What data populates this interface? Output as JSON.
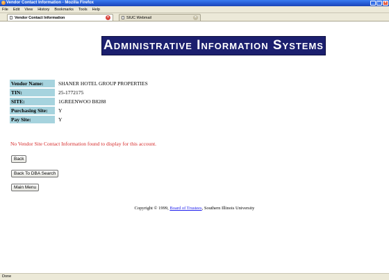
{
  "window": {
    "title": "Vendor Contact Information - Mozilla Firefox",
    "controls": {
      "minimize": "_",
      "maximize": "□",
      "close": "×"
    }
  },
  "menu": [
    "File",
    "Edit",
    "View",
    "History",
    "Bookmarks",
    "Tools",
    "Help"
  ],
  "tabs": [
    {
      "label": "Vendor Contact Information",
      "close": "×"
    },
    {
      "label": "SIUC Webmail",
      "close": "×"
    }
  ],
  "page": {
    "banner": "Administrative Information Systems",
    "vendor": [
      {
        "label": "Vendor Name:",
        "value": "SHANER HOTEL GROUP PROPERTIES"
      },
      {
        "label": "TIN:",
        "value": "25-1772175"
      },
      {
        "label": "SITE:",
        "value": "1GREENWOO B8288"
      },
      {
        "label": "Purchasing Site:",
        "value": "Y"
      },
      {
        "label": "Pay Site:",
        "value": "Y"
      }
    ],
    "message": "No Vendor Site Contact Information found to display for this account.",
    "buttons": {
      "back": "Back",
      "dba_search": "Back To DBA Search",
      "main_menu": "Main Menu"
    },
    "copyright": {
      "prefix": "Copyright © 1999, ",
      "link": "Board of Trustees",
      "suffix": ", Southern Illinois University"
    }
  },
  "status": "Done",
  "colors": {
    "banner_bg": "#1b1f6e",
    "label_bg": "#a6d3de",
    "message": "#d62a2a",
    "link": "#1a1aee"
  }
}
